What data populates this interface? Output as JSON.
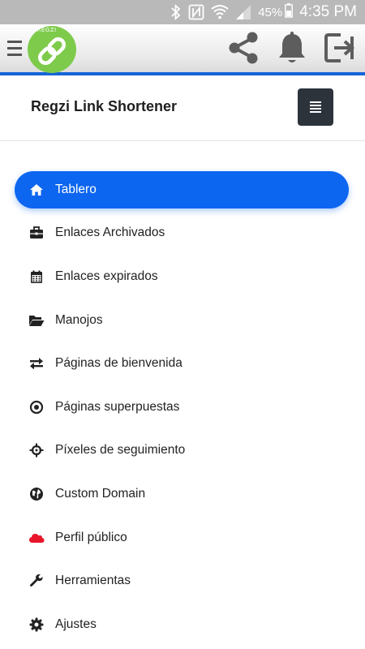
{
  "status_bar": {
    "battery": "45%",
    "time": "4:35 PM",
    "icons": [
      "bluetooth-icon",
      "nfc-icon",
      "wifi-icon",
      "signal-icon",
      "battery-icon"
    ]
  },
  "app_bar": {
    "logo_tag": "@REGZI",
    "actions": [
      "share-icon",
      "bell-icon",
      "logout-icon"
    ]
  },
  "header": {
    "title": "Regzi Link Shortener"
  },
  "menu": {
    "items": [
      {
        "label": "Tablero",
        "icon": "home-icon",
        "active": true
      },
      {
        "label": "Enlaces Archivados",
        "icon": "briefcase-icon",
        "active": false
      },
      {
        "label": "Enlaces expirados",
        "icon": "calendar-icon",
        "active": false
      },
      {
        "label": "Manojos",
        "icon": "folder-open-icon",
        "active": false
      },
      {
        "label": "Páginas de bienvenida",
        "icon": "exchange-icon",
        "active": false
      },
      {
        "label": "Páginas superpuestas",
        "icon": "dot-circle-icon",
        "active": false
      },
      {
        "label": "Píxeles de seguimiento",
        "icon": "crosshairs-icon",
        "active": false
      },
      {
        "label": "Custom Domain",
        "icon": "globe-icon",
        "active": false
      },
      {
        "label": "Perfil público",
        "icon": "cloud-icon",
        "active": false
      },
      {
        "label": "Herramientas",
        "icon": "wrench-icon",
        "active": false
      },
      {
        "label": "Ajustes",
        "icon": "cog-icon",
        "active": false
      }
    ]
  },
  "colors": {
    "accent": "#0d66f0",
    "app_bar_border": "#1565d8",
    "cloud_icon": "#e8162b",
    "toggle_bg": "#2d333b",
    "logo_green": "#7ecb4c"
  }
}
